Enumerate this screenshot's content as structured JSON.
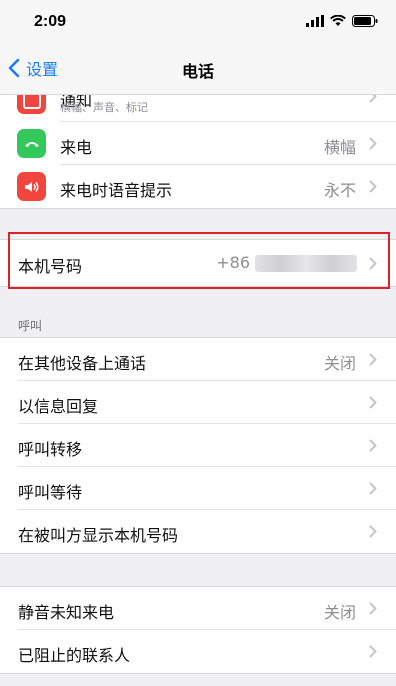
{
  "status": {
    "time": "2:09"
  },
  "nav": {
    "back_label": "设置",
    "title": "电话"
  },
  "top_group": {
    "partial_label": "通知",
    "partial_sub": "横幅、声音、标记",
    "ringtone_label": "来电",
    "ringtone_value": "横幅",
    "announce_label": "来电时语音提示",
    "announce_value": "永不"
  },
  "my_number": {
    "label": "本机号码",
    "value": "+86"
  },
  "calls_section": {
    "header": "呼叫",
    "items": [
      {
        "label": "在其他设备上通话",
        "value": "关闭"
      },
      {
        "label": "以信息回复",
        "value": ""
      },
      {
        "label": "呼叫转移",
        "value": ""
      },
      {
        "label": "呼叫等待",
        "value": ""
      },
      {
        "label": "在被叫方显示本机号码",
        "value": ""
      }
    ]
  },
  "bottom_section": {
    "items": [
      {
        "label": "静音未知来电",
        "value": "关闭"
      },
      {
        "label": "已阻止的联系人",
        "value": ""
      }
    ]
  },
  "colors": {
    "accent": "#1a7cf5",
    "phone_green": "#34c759",
    "speaker_red": "#f2453d",
    "highlight_red": "#d9232a"
  }
}
